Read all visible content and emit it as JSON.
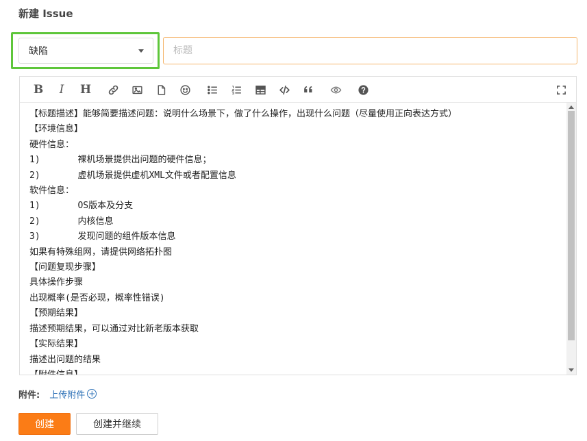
{
  "page": {
    "title": "新建 Issue"
  },
  "issue_type": {
    "selected": "缺陷"
  },
  "title_field": {
    "placeholder": "标题",
    "value": ""
  },
  "editor": {
    "toolbar": [
      {
        "name": "bold-icon",
        "label": "B"
      },
      {
        "name": "italic-icon",
        "label": "I"
      },
      {
        "name": "heading-icon",
        "label": "H"
      },
      {
        "name": "link-icon",
        "label": ""
      },
      {
        "name": "image-icon",
        "label": ""
      },
      {
        "name": "file-icon",
        "label": ""
      },
      {
        "name": "emoji-icon",
        "label": ""
      },
      {
        "name": "unordered-list-icon",
        "label": ""
      },
      {
        "name": "ordered-list-icon",
        "label": ""
      },
      {
        "name": "table-icon",
        "label": ""
      },
      {
        "name": "code-icon",
        "label": ""
      },
      {
        "name": "quote-icon",
        "label": ""
      },
      {
        "name": "preview-icon",
        "label": ""
      },
      {
        "name": "help-icon",
        "label": ""
      },
      {
        "name": "fullscreen-icon",
        "label": ""
      }
    ],
    "lines": [
      "【标题描述】能够简要描述问题：说明什么场景下，做了什么操作，出现什么问题（尽量使用正向表达方式）",
      "【环境信息】",
      "硬件信息：",
      "1)       裸机场景提供出问题的硬件信息；",
      "2)       虚机场景提供虚机XML文件或者配置信息",
      "软件信息：",
      "1)       OS版本及分支",
      "2)       内核信息",
      "3)       发现问题的组件版本信息",
      "如果有特殊组网，请提供网络拓扑图",
      "【问题复现步骤】",
      "具体操作步骤",
      "出现概率(是否必现，概率性错误)",
      "【预期结果】",
      "描述预期结果，可以通过对比新老版本获取",
      "【实际结果】",
      "描述出问题的结果",
      "【附件信息】"
    ]
  },
  "attachments": {
    "label": "附件:",
    "upload_link": "上传附件"
  },
  "actions": {
    "create": "创建",
    "create_continue": "创建并继续"
  },
  "colors": {
    "accent": "#fb7c16",
    "highlight": "#5ec63a",
    "link": "#2a6fb6"
  }
}
